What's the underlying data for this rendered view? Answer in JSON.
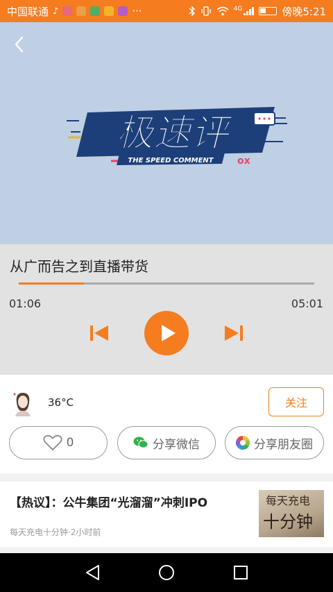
{
  "status_bar": {
    "carrier": "中国联通",
    "network": "4G",
    "time": "傍晚5:21",
    "more": "···",
    "app_icon_colors": [
      "#e86a7a",
      "#e9a04b",
      "#4fae66",
      "#f0b52a",
      "#b75bc5"
    ]
  },
  "colors": {
    "accent": "#f57c1f",
    "player_bg": "#e2e2e2",
    "cover_bg": "#bfd0e4"
  },
  "cover": {
    "logo_main": "极速评",
    "logo_sub": "THE SPEED COMMENT",
    "logo_mark": "ox"
  },
  "player": {
    "title": "从广而告之到直播带货",
    "current_time": "01:06",
    "total_time": "05:01",
    "progress": 0.22
  },
  "author": {
    "name": "36°C",
    "follow_label": "关注",
    "like_count": "0",
    "share_wechat_label": "分享微信",
    "share_moments_label": "分享朋友圈"
  },
  "news": {
    "title": "【热议】：公牛集团“光溜溜”冲刺IPO",
    "meta": "每天充电十分钟·2小时前",
    "thumb_line1": "每天充电",
    "thumb_line2": "十分钟"
  }
}
